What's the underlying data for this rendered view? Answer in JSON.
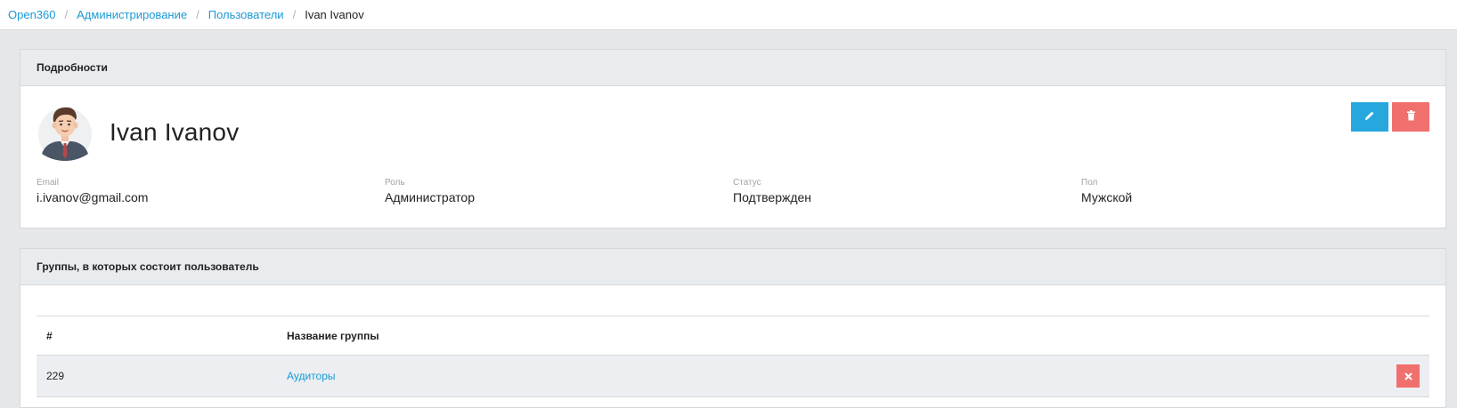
{
  "breadcrumb": {
    "items": [
      "Open360",
      "Администрирование",
      "Пользователи"
    ],
    "separator": "/",
    "current": "Ivan Ivanov"
  },
  "details": {
    "header": "Подробности",
    "user_name": "Ivan Ivanov",
    "fields": [
      {
        "label": "Email",
        "value": "i.ivanov@gmail.com"
      },
      {
        "label": "Роль",
        "value": "Администратор"
      },
      {
        "label": "Статус",
        "value": "Подтвержден"
      },
      {
        "label": "Пол",
        "value": "Мужской"
      }
    ],
    "actions": {
      "edit_icon": "pencil-icon",
      "delete_icon": "trash-icon"
    }
  },
  "groups": {
    "header": "Группы, в которых состоит пользователь",
    "columns": [
      "#",
      "Название группы"
    ],
    "rows": [
      {
        "id": "229",
        "name": "Аудиторы",
        "remove_icon": "close-icon"
      }
    ]
  },
  "colors": {
    "link": "#1a9ad6",
    "edit_button": "#26a8de",
    "delete_button": "#f0706e",
    "header_bg": "#e9ecef"
  }
}
